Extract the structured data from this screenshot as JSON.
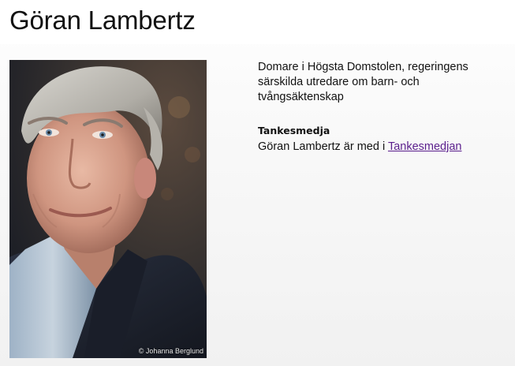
{
  "page": {
    "title": "Göran Lambertz"
  },
  "portrait": {
    "credit": "© Johanna Berglund"
  },
  "bio": {
    "text": "Domare i Högsta Domstolen, regeringens särskilda utredare om barn- och tvångsäktenskap"
  },
  "think_tank": {
    "heading": "Tankesmedja",
    "text_before_link": "Göran Lambertz är med i ",
    "link_label": "Tankesmedjan"
  },
  "colors": {
    "link": "#5a1e8c",
    "text": "#111111"
  }
}
